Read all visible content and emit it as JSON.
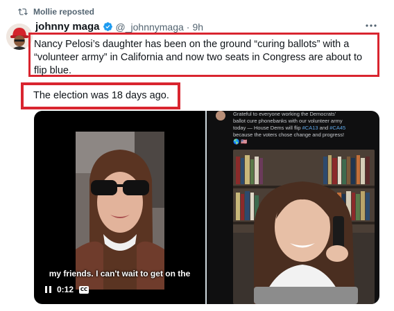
{
  "repost": {
    "label": "Mollie reposted",
    "icon": "repost-icon"
  },
  "tweet": {
    "author_name": "johnny maga",
    "handle": "@_johnnymaga",
    "separator": "·",
    "time": "9h",
    "text_line1": "Nancy Pelosi’s daughter has been on the ground “curing ballots” with a “volunteer army” in California and now two seats in Congress are about to flip blue.",
    "text_line2": "The election was 18 days ago.",
    "more_icon": "more-options-icon"
  },
  "video": {
    "caption": "my friends. I can't wait to get on the",
    "time": "0:12",
    "cc_label": "CC",
    "pause_icon": "pause-icon"
  },
  "embedded": {
    "text_a": "Grateful to everyone working the Democrats'",
    "text_b": "ballot cure phonebanks with our volunteer army",
    "text_c": "today — House Dems will flip ",
    "tag1": "#CA13",
    "text_and": " and ",
    "tag2": "#CA45",
    "text_d": "because the voters chose change and progress!",
    "emoji": "🌎 🇺🇸"
  },
  "colors": {
    "highlight_border": "#d9252f",
    "verified": "#1d9bf0",
    "muted": "#536471"
  }
}
